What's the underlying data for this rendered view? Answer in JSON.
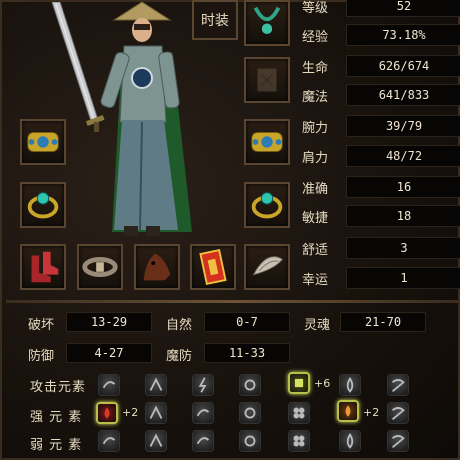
{
  "equipment_panel": {
    "fashion_button": "时装",
    "stats": [
      {
        "label": "等级",
        "value": "52"
      },
      {
        "label": "经验",
        "value": "73.18%"
      },
      {
        "label": "生命",
        "value": "626/674"
      },
      {
        "label": "魔法",
        "value": "641/833"
      },
      {
        "label": "腕力",
        "value": "39/79"
      },
      {
        "label": "肩力",
        "value": "48/72"
      },
      {
        "label": "准确",
        "value": "16"
      },
      {
        "label": "敏捷",
        "value": "18"
      },
      {
        "label": "舒适",
        "value": "3"
      },
      {
        "label": "幸运",
        "value": "1"
      }
    ],
    "attributes": [
      {
        "label": "破坏",
        "value": "13-29"
      },
      {
        "label": "自然",
        "value": "0-7"
      },
      {
        "label": "灵魂",
        "value": "21-70"
      },
      {
        "label": "防御",
        "value": "4-27"
      },
      {
        "label": "魔防",
        "value": "11-33"
      }
    ],
    "elements": {
      "attack_label": "攻击元素",
      "strong_label": "强 元 素",
      "weak_label": "弱 元 素",
      "attack_bonus": "+6",
      "strong_bonus_1": "+2",
      "strong_bonus_2": "+2"
    },
    "colors": {
      "frame": "#5a4630",
      "value_bg": "#080604",
      "highlight": "#b8c04a"
    }
  }
}
